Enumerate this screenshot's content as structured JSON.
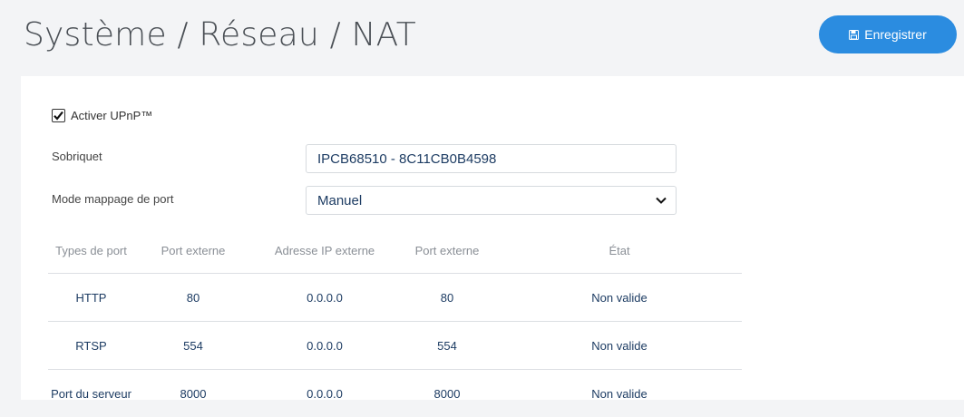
{
  "header": {
    "title": "Système / Réseau / NAT",
    "save_label": "Enregistrer",
    "save_icon": "floppy-disk-icon"
  },
  "form": {
    "upnp_label": "Activer UPnP™",
    "upnp_checked": true,
    "nickname_label": "Sobriquet",
    "nickname_value": "IPCB68510 - 8C11CB0B4598",
    "mapping_label": "Mode mappage de port",
    "mapping_value": "Manuel"
  },
  "table": {
    "headers": [
      "Types de port",
      "Port externe",
      "Adresse IP externe",
      "Port externe",
      "État"
    ],
    "rows": [
      [
        "HTTP",
        "80",
        "0.0.0.0",
        "80",
        "Non valide"
      ],
      [
        "RTSP",
        "554",
        "0.0.0.0",
        "554",
        "Non valide"
      ],
      [
        "Port du serveur",
        "8000",
        "0.0.0.0",
        "8000",
        "Non valide"
      ]
    ]
  },
  "colors": {
    "accent": "#2b8ce0",
    "value_text": "#1d3c63",
    "background": "#f3f4f6"
  }
}
